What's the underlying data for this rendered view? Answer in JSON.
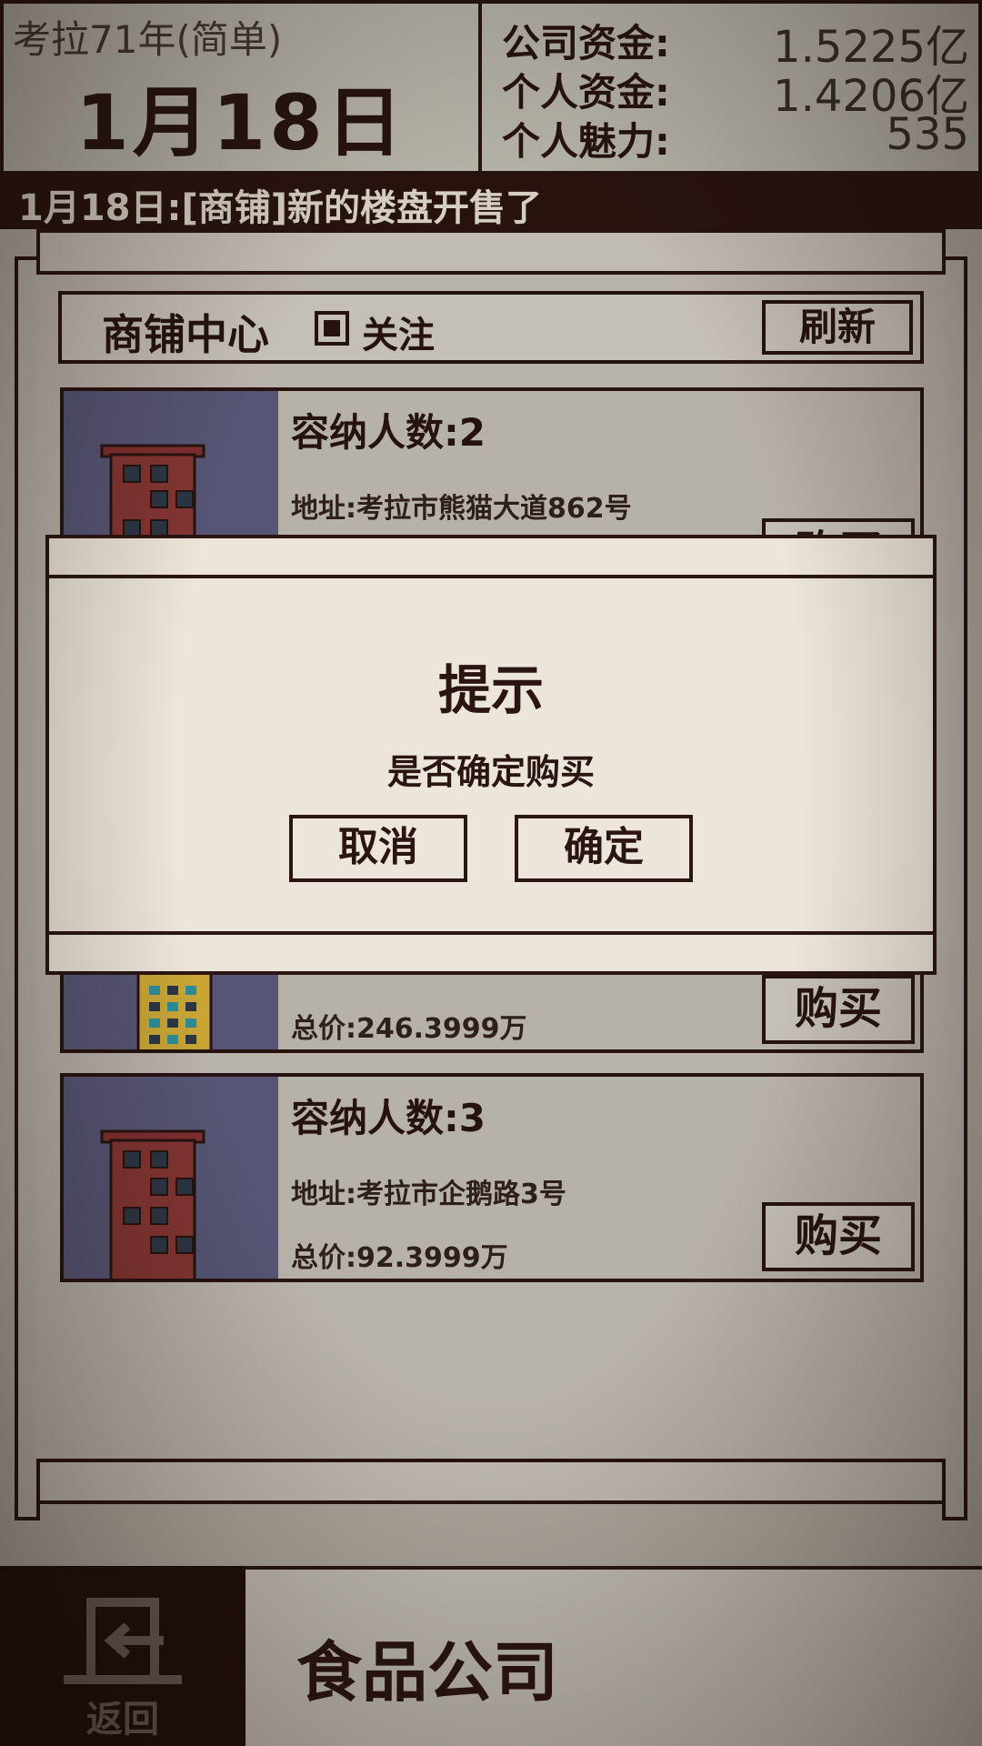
{
  "header": {
    "year": "考拉71年(简单)",
    "date": "1月18日",
    "stats": [
      {
        "label": "公司资金:",
        "value": "1.5225亿"
      },
      {
        "label": "个人资金:",
        "value": "1.4206亿"
      },
      {
        "label": "个人魅力:",
        "value": "535"
      }
    ]
  },
  "ticker": "1月18日:[商铺]新的楼盘开售了",
  "panel": {
    "title": "商铺中心",
    "follow_label": "关注",
    "follow_checked": true,
    "refresh_label": "刷新"
  },
  "listings": [
    {
      "capacity": "容纳人数:2",
      "address": "地址:考拉市熊猫大道862号",
      "price": "",
      "buy_label": "购买"
    },
    {
      "capacity": "",
      "address": "",
      "price": "总价:246.3999万",
      "buy_label": "购买"
    },
    {
      "capacity": "容纳人数:3",
      "address": "地址:考拉市企鹅路3号",
      "price": "总价:92.3999万",
      "buy_label": "购买"
    }
  ],
  "dialog": {
    "title": "提示",
    "message": "是否确定购买",
    "cancel_label": "取消",
    "confirm_label": "确定"
  },
  "bottom": {
    "back_label": "返回",
    "company_name": "食品公司"
  },
  "colors": {
    "ink": "#2a1512",
    "paper": "#ece6da",
    "ticker_bg": "#2b1410",
    "listing_image_bg": "#5e5d7f"
  }
}
